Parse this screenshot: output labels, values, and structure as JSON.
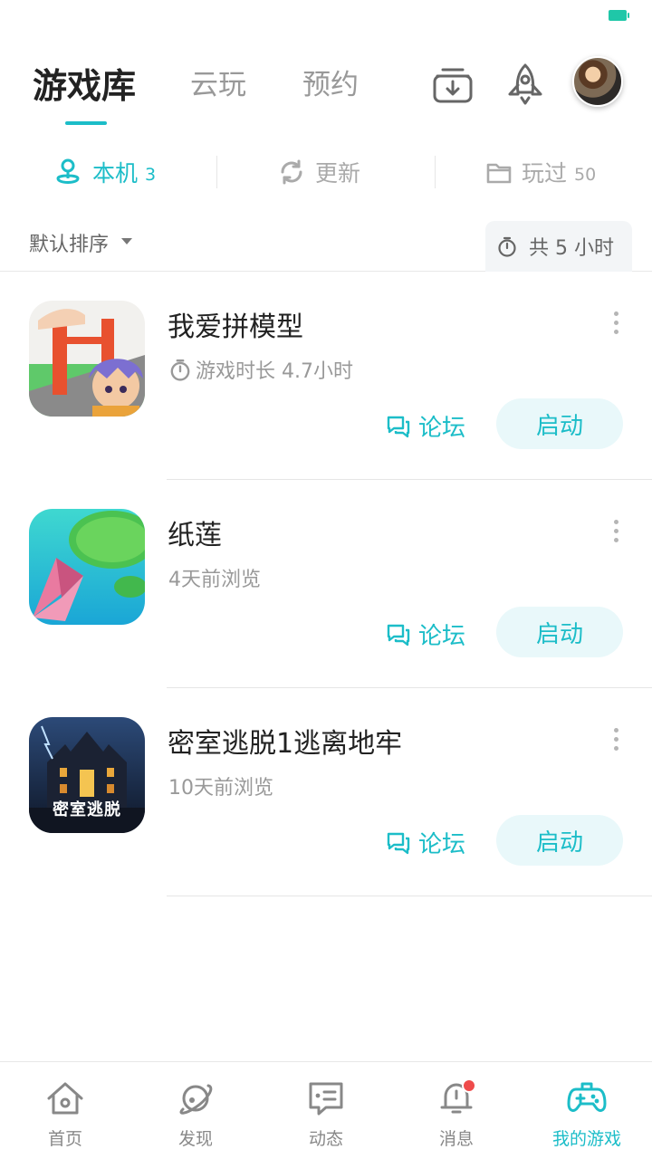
{
  "header": {
    "tabs": [
      {
        "label": "游戏库",
        "active": true
      },
      {
        "label": "云玩",
        "active": false
      },
      {
        "label": "预约",
        "active": false
      }
    ],
    "icons": [
      "download-icon",
      "rocket-icon"
    ],
    "accent_color": "#1cbdc8"
  },
  "subtabs": [
    {
      "label": "本机",
      "count": "3",
      "icon": "local-device-icon",
      "active": true
    },
    {
      "label": "更新",
      "count": "",
      "icon": "refresh-icon",
      "active": false
    },
    {
      "label": "玩过",
      "count": "50",
      "icon": "folder-icon",
      "active": false
    }
  ],
  "sortbar": {
    "sort_label": "默认排序",
    "total_time": "共 5 小时"
  },
  "games": [
    {
      "title": "我爱拼模型",
      "subtitle": "游戏时长 4.7小时",
      "has_timer": true,
      "forum_label": "论坛",
      "launch_label": "启动"
    },
    {
      "title": "纸莲",
      "subtitle": "4天前浏览",
      "has_timer": false,
      "forum_label": "论坛",
      "launch_label": "启动"
    },
    {
      "title": "密室逃脱1逃离地牢",
      "subtitle": "10天前浏览",
      "has_timer": false,
      "forum_label": "论坛",
      "launch_label": "启动",
      "icon_caption": "密室逃脱"
    }
  ],
  "bottom_nav": [
    {
      "label": "首页",
      "icon": "home-icon",
      "active": false
    },
    {
      "label": "发现",
      "icon": "planet-icon",
      "active": false
    },
    {
      "label": "动态",
      "icon": "message-box-icon",
      "active": false
    },
    {
      "label": "消息",
      "icon": "bell-icon",
      "active": false,
      "badge": true
    },
    {
      "label": "我的游戏",
      "icon": "gamepad-icon",
      "active": true
    }
  ]
}
